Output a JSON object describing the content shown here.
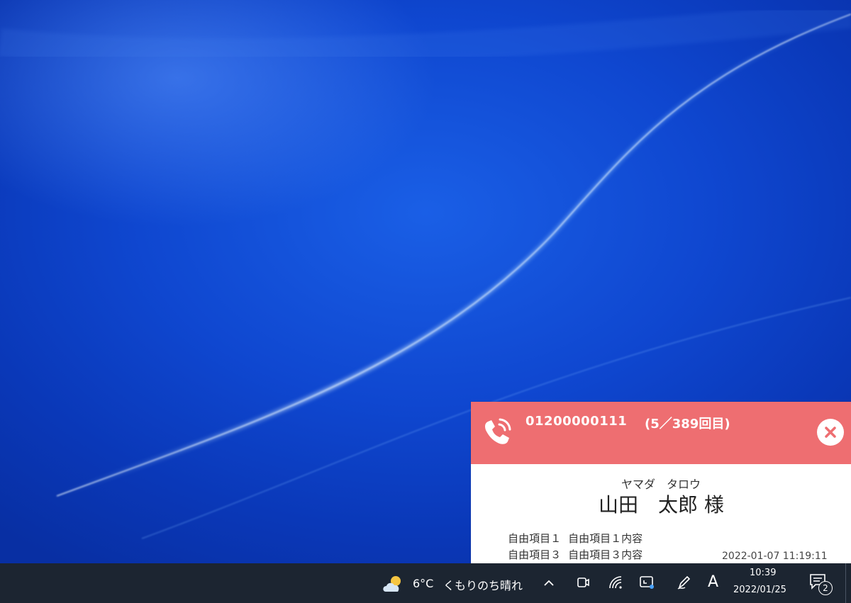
{
  "popup": {
    "phone_number": "01200000111",
    "call_count": "(5／389回目)",
    "kana_name": "ヤマダ　タロウ",
    "name": "山田　太郎 様",
    "free_items": [
      {
        "label": "自由項目１",
        "value": "自由項目１内容"
      },
      {
        "label": "自由項目３",
        "value": "自由項目３内容"
      }
    ],
    "timestamp": "2022-01-07 11:19:11",
    "header_color": "#ee6e71",
    "icons": {
      "phone": "phone-ringing-icon",
      "close": "close-icon"
    }
  },
  "taskbar": {
    "weather": {
      "temperature": "6°C",
      "condition": "くもりのち晴れ",
      "icon": "partly-cloudy-icon"
    },
    "tray_icons": [
      "chevron-up-icon",
      "meet-now-icon",
      "wifi-icon",
      "screen-capture-icon",
      "pen-icon"
    ],
    "ime_indicator": "A",
    "clock": {
      "time": "10:39",
      "date": "2022/01/25"
    },
    "notifications": {
      "count": "2",
      "icon": "notification-center-icon"
    },
    "background_color": "#1c2531"
  }
}
